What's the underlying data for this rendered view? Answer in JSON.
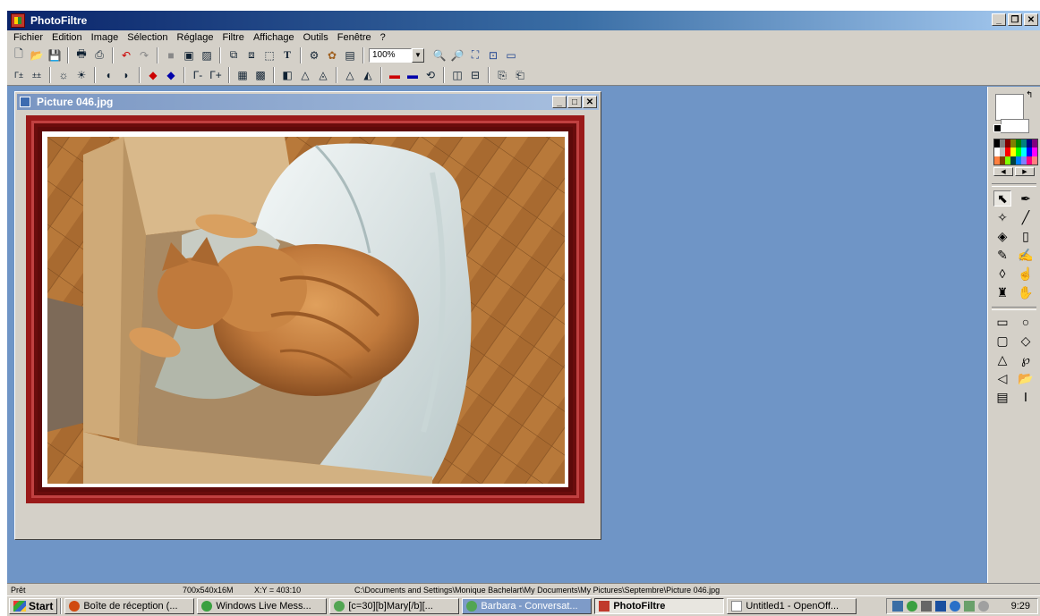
{
  "app": {
    "title": "PhotoFiltre"
  },
  "menu": [
    "Fichier",
    "Edition",
    "Image",
    "Sélection",
    "Réglage",
    "Filtre",
    "Affichage",
    "Outils",
    "Fenêtre",
    "?"
  ],
  "toolbar": {
    "zoom_value": "100%"
  },
  "document": {
    "title": "Picture 046.jpg"
  },
  "status": {
    "state": "Prêt",
    "image_info": "700x540x16M",
    "coords": "X:Y = 403:10",
    "path": "C:\\Documents and Settings\\Monique Bachelart\\My Documents\\My Pictures\\Septembre\\Picture 046.jpg"
  },
  "taskbar": {
    "start_label": "Start",
    "tasks": [
      {
        "label": "Boîte de réception (...",
        "icon": "thunderbird-icon"
      },
      {
        "label": "Windows Live Mess...",
        "icon": "messenger-icon"
      },
      {
        "label": "[c=30][b]Mary[/b][...",
        "icon": "chat-icon"
      },
      {
        "label": "Barbara - Conversat...",
        "icon": "chat-icon"
      },
      {
        "label": "PhotoFiltre",
        "icon": "photofiltre-icon"
      },
      {
        "label": "Untitled1 - OpenOff...",
        "icon": "writer-icon"
      }
    ],
    "clock": "9:29"
  },
  "colors": {
    "workspace": "#6f95c6",
    "frame": "#9a1a1a",
    "chrome": "#d4d0c8"
  }
}
